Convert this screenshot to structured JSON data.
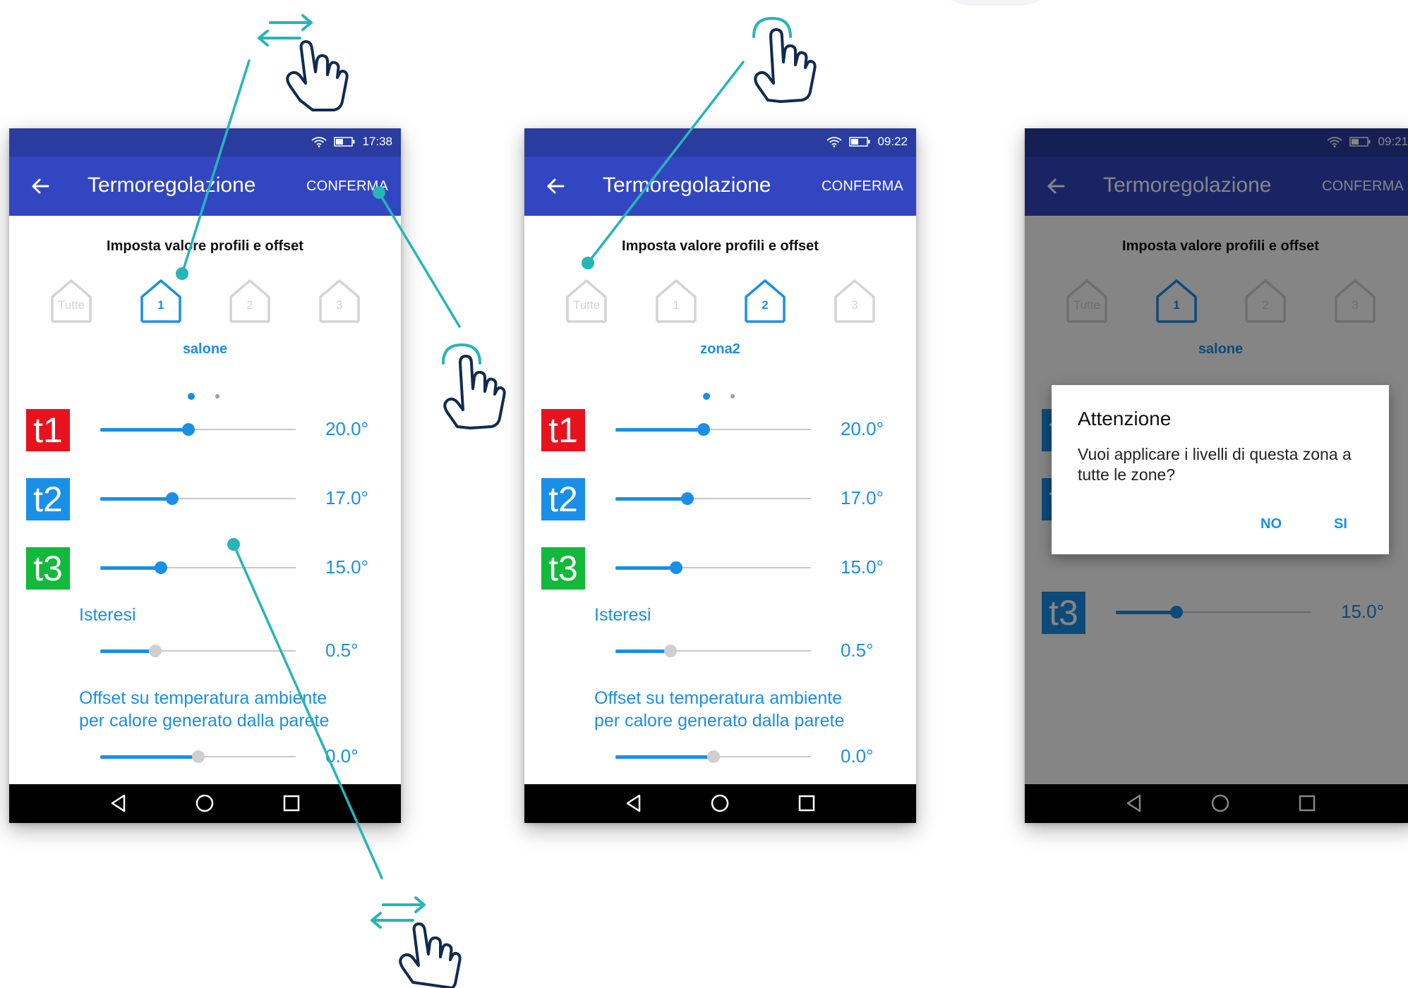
{
  "colors": {
    "appbar": "#3346c2",
    "statusbar": "#2a3ca0",
    "accent": "#1a8fe8",
    "t1": "#e8121e",
    "t2": "#1a8fe8",
    "t3": "#12b93a",
    "gesture_line": "#26b5b8",
    "hand_outline": "#0f2b52"
  },
  "icons": {
    "hands": [
      "swipe-hand-icon",
      "tap-hand-icon",
      "tap-hand-icon",
      "swipe-hand-icon"
    ],
    "status": [
      "wifi-icon",
      "battery-icon"
    ],
    "nav": [
      "nav-back-icon",
      "nav-home-icon",
      "nav-recents-icon"
    ]
  },
  "screens": [
    {
      "time": "17:38",
      "app_title": "Termoregolazione",
      "confirm_label": "CONFERMA",
      "section_title": "Imposta valore profili e offset",
      "zones": [
        "Tutte",
        "1",
        "2",
        "3"
      ],
      "active_zone": 1,
      "zone_name": "salone",
      "levels": [
        {
          "badge": "t1",
          "value": "20.0°",
          "slider_fraction": 0.45
        },
        {
          "badge": "t2",
          "value": "17.0°",
          "slider_fraction": 0.37
        },
        {
          "badge": "t3",
          "value": "15.0°",
          "slider_fraction": 0.31
        }
      ],
      "hysteresis": {
        "label": "Isteresi",
        "value": "0.5°",
        "slider_fraction": 0.28
      },
      "offset": {
        "label_line1": "Offset su temperatura ambiente",
        "label_line2": "per calore generato dalla parete",
        "value": "0.0°",
        "slider_fraction": 0.5
      }
    },
    {
      "time": "09:22",
      "app_title": "Termoregolazione",
      "confirm_label": "CONFERMA",
      "section_title": "Imposta valore profili e offset",
      "zones": [
        "Tutte",
        "1",
        "2",
        "3"
      ],
      "active_zone": 2,
      "zone_name": "zona2",
      "levels": [
        {
          "badge": "t1",
          "value": "20.0°",
          "slider_fraction": 0.45
        },
        {
          "badge": "t2",
          "value": "17.0°",
          "slider_fraction": 0.37
        },
        {
          "badge": "t3",
          "value": "15.0°",
          "slider_fraction": 0.31
        }
      ],
      "hysteresis": {
        "label": "Isteresi",
        "value": "0.5°",
        "slider_fraction": 0.28
      },
      "offset": {
        "label_line1": "Offset su temperatura ambiente",
        "label_line2": "per calore generato dalla parete",
        "value": "0.0°",
        "slider_fraction": 0.5
      }
    },
    {
      "time": "09:21",
      "app_title": "Termoregolazione",
      "confirm_label": "CONFERMA",
      "section_title": "Imposta valore profili e offset",
      "zones": [
        "Tutte",
        "1",
        "2",
        "3"
      ],
      "active_zone": 1,
      "zone_name": "salone",
      "levels": [
        {
          "badge": "t1",
          "value": "",
          "slider_fraction": 0.45
        },
        {
          "badge": "t2",
          "value": "",
          "slider_fraction": 0.37
        },
        {
          "badge": "t3",
          "value": "15.0°",
          "slider_fraction": 0.31
        }
      ],
      "dialog": {
        "title": "Attenzione",
        "message": "Vuoi applicare i livelli di questa zona a tutte le zone?",
        "no_label": "NO",
        "yes_label": "SI"
      }
    }
  ]
}
